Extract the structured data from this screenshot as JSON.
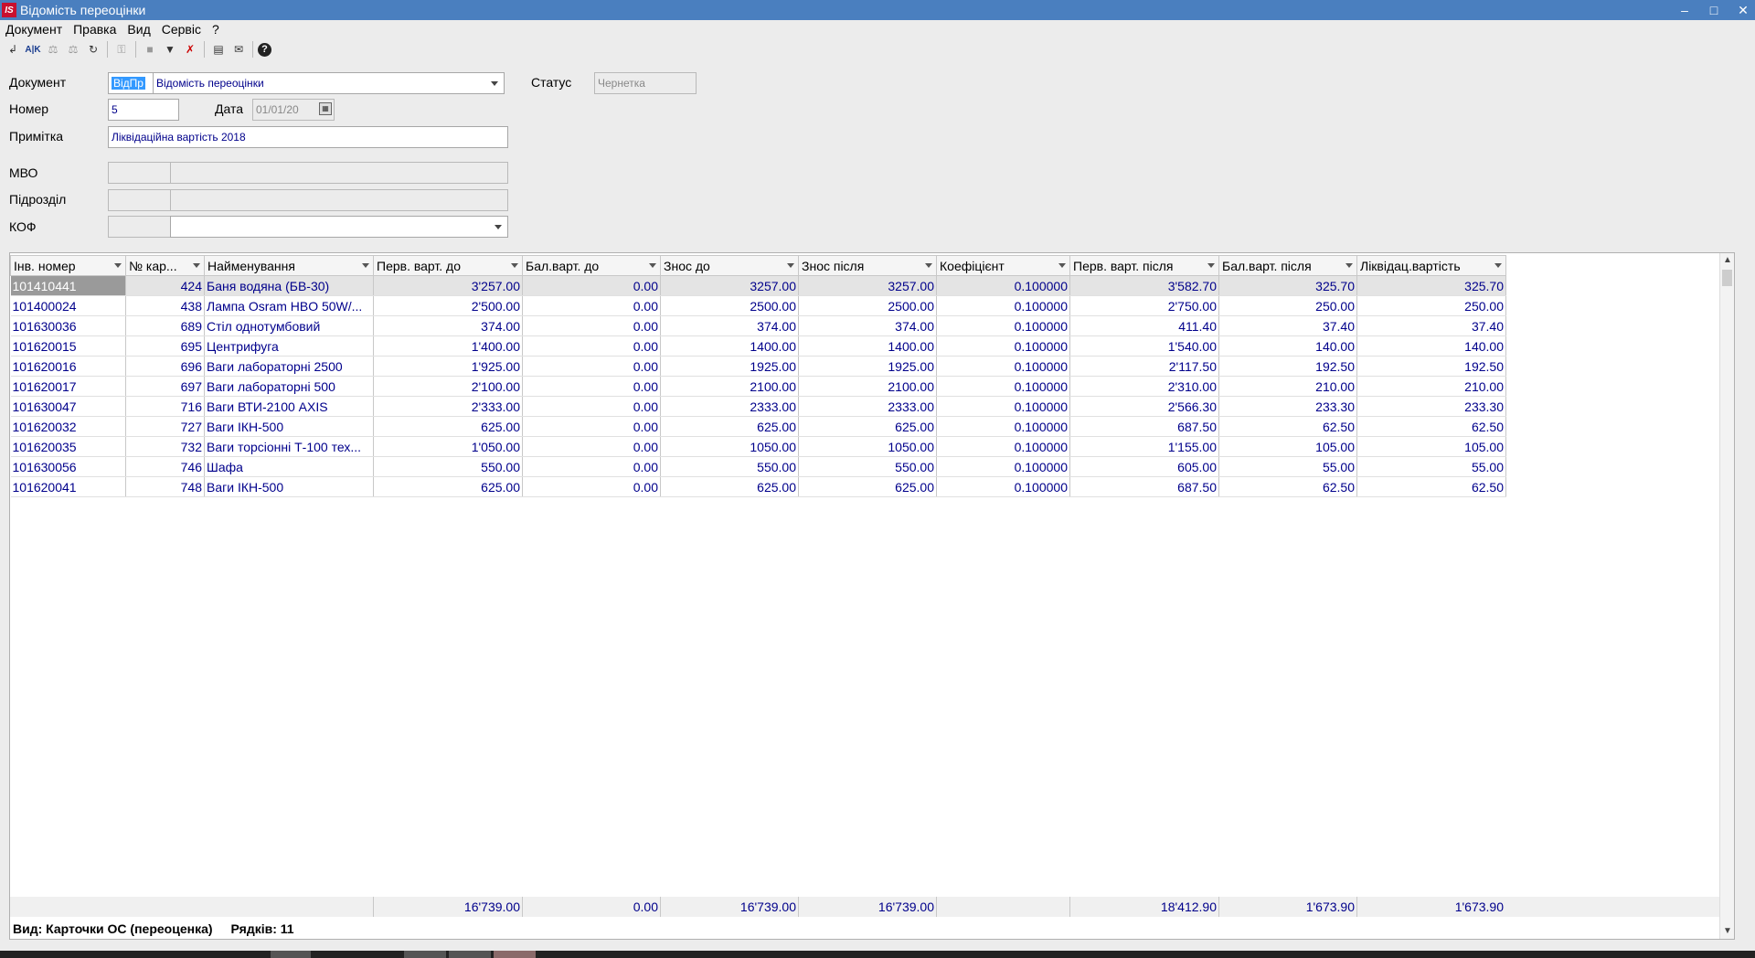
{
  "window": {
    "title": "Відомість переоцінки",
    "logo": "IS"
  },
  "menu": [
    "Документ",
    "Правка",
    "Вид",
    "Сервіс",
    "?"
  ],
  "toolbar_icons": [
    "new-doc-icon",
    "rename-icon",
    "scale-icon",
    "scale-down-icon",
    "refresh-icon",
    "key-icon",
    "stop-icon",
    "filter-icon",
    "clear-filter-icon",
    "report-icon",
    "mail-icon",
    "help-icon"
  ],
  "form": {
    "document_label": "Документ",
    "document_code": "ВідПр",
    "document_name": "Відомість переоцінки",
    "status_label": "Статус",
    "status_value": "Чернетка",
    "number_label": "Номер",
    "number_value": "5",
    "date_label": "Дата",
    "date_value": "01/01/20",
    "note_label": "Примітка",
    "note_value": "Ліквідаційна вартість 2018",
    "mvo_label": "МВО",
    "department_label": "Підрозділ",
    "kof_label": "КОФ"
  },
  "table": {
    "columns": [
      "Інв. номер",
      "№ кар...",
      "Найменування",
      "Перв. варт. до",
      "Бал.варт. до",
      "Знос до",
      "Знос після",
      "Коефіцієнт",
      "Перв. варт. після",
      "Бал.варт. після",
      "Ліквідац.вартість"
    ],
    "rows": [
      [
        "101410441",
        "424",
        "Баня водяна (БВ-30)",
        "3'257.00",
        "0.00",
        "3257.00",
        "3257.00",
        "0.100000",
        "3'582.70",
        "325.70",
        "325.70"
      ],
      [
        "101400024",
        "438",
        "Лампа Osram HBO 50W/...",
        "2'500.00",
        "0.00",
        "2500.00",
        "2500.00",
        "0.100000",
        "2'750.00",
        "250.00",
        "250.00"
      ],
      [
        "101630036",
        "689",
        "Стіл однотумбовий",
        "374.00",
        "0.00",
        "374.00",
        "374.00",
        "0.100000",
        "411.40",
        "37.40",
        "37.40"
      ],
      [
        "101620015",
        "695",
        "Центрифуга",
        "1'400.00",
        "0.00",
        "1400.00",
        "1400.00",
        "0.100000",
        "1'540.00",
        "140.00",
        "140.00"
      ],
      [
        "101620016",
        "696",
        "Ваги лабораторні 2500",
        "1'925.00",
        "0.00",
        "1925.00",
        "1925.00",
        "0.100000",
        "2'117.50",
        "192.50",
        "192.50"
      ],
      [
        "101620017",
        "697",
        "Ваги лабораторні 500",
        "2'100.00",
        "0.00",
        "2100.00",
        "2100.00",
        "0.100000",
        "2'310.00",
        "210.00",
        "210.00"
      ],
      [
        "101630047",
        "716",
        "Ваги ВТИ-2100 AXIS",
        "2'333.00",
        "0.00",
        "2333.00",
        "2333.00",
        "0.100000",
        "2'566.30",
        "233.30",
        "233.30"
      ],
      [
        "101620032",
        "727",
        "Ваги ІКН-500",
        "625.00",
        "0.00",
        "625.00",
        "625.00",
        "0.100000",
        "687.50",
        "62.50",
        "62.50"
      ],
      [
        "101620035",
        "732",
        "Ваги торсіонні Т-100 тех...",
        "1'050.00",
        "0.00",
        "1050.00",
        "1050.00",
        "0.100000",
        "1'155.00",
        "105.00",
        "105.00"
      ],
      [
        "101630056",
        "746",
        "Шафа",
        "550.00",
        "0.00",
        "550.00",
        "550.00",
        "0.100000",
        "605.00",
        "55.00",
        "55.00"
      ],
      [
        "101620041",
        "748",
        "Ваги ІКН-500",
        "625.00",
        "0.00",
        "625.00",
        "625.00",
        "0.100000",
        "687.50",
        "62.50",
        "62.50"
      ]
    ],
    "totals": {
      "perv_do": "16'739.00",
      "bal_do": "0.00",
      "znos_do": "16'739.00",
      "znos_pislia": "16'739.00",
      "perv_pislia": "18'412.90",
      "bal_pislia": "1'673.90",
      "likvid": "1'673.90"
    }
  },
  "status": {
    "view": "Вид: Карточки ОС (переоценка)",
    "rows": "Рядків: 11"
  }
}
